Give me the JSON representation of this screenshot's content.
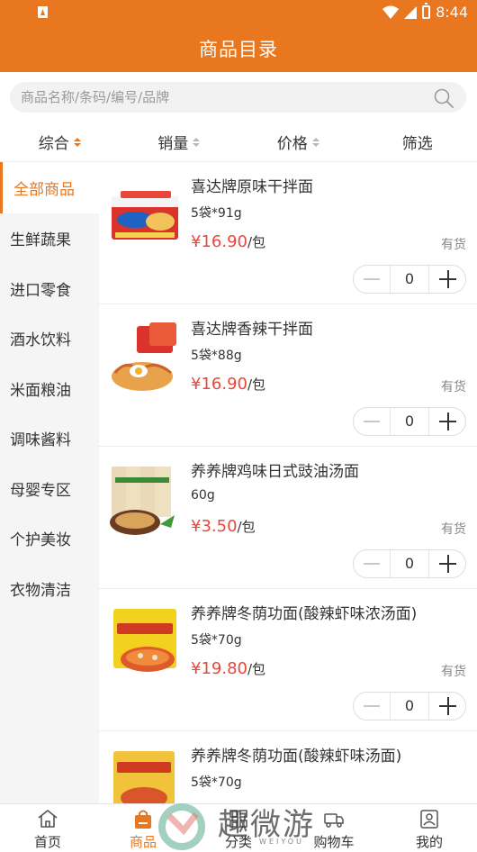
{
  "status_bar": {
    "time": "8:44"
  },
  "header": {
    "title": "商品目录"
  },
  "search": {
    "placeholder": "商品名称/条码/编号/品牌"
  },
  "sort": {
    "items": [
      {
        "label": "综合"
      },
      {
        "label": "销量"
      },
      {
        "label": "价格"
      },
      {
        "label": "筛选"
      }
    ]
  },
  "sidebar": {
    "items": [
      {
        "label": "全部商品"
      },
      {
        "label": "生鲜蔬果"
      },
      {
        "label": "进口零食"
      },
      {
        "label": "酒水饮料"
      },
      {
        "label": "米面粮油"
      },
      {
        "label": "调味酱料"
      },
      {
        "label": "母婴专区"
      },
      {
        "label": "个护美妆"
      },
      {
        "label": "衣物清洁"
      }
    ]
  },
  "products": [
    {
      "name": "喜达牌原味干拌面",
      "spec": "5袋*91g",
      "price": "¥16.90",
      "unit": "/包",
      "stock": "有货",
      "qty": "0"
    },
    {
      "name": "喜达牌香辣干拌面",
      "spec": "5袋*88g",
      "price": "¥16.90",
      "unit": "/包",
      "stock": "有货",
      "qty": "0"
    },
    {
      "name": "养养牌鸡味日式豉油汤面",
      "spec": "60g",
      "price": "¥3.50",
      "unit": "/包",
      "stock": "有货",
      "qty": "0"
    },
    {
      "name": "养养牌冬荫功面(酸辣虾味浓汤面)",
      "spec": "5袋*70g",
      "price": "¥19.80",
      "unit": "/包",
      "stock": "有货",
      "qty": "0"
    },
    {
      "name": "养养牌冬荫功面(酸辣虾味汤面)",
      "spec": "5袋*70g"
    }
  ],
  "tabbar": {
    "items": [
      {
        "label": "首页"
      },
      {
        "label": "商品"
      },
      {
        "label": "分类"
      },
      {
        "label": "购物车"
      },
      {
        "label": "我的"
      }
    ]
  },
  "watermark": {
    "text": "趣微游",
    "sub": "WEIYOU"
  },
  "colors": {
    "accent": "#e8771f",
    "price": "#e8473c"
  }
}
